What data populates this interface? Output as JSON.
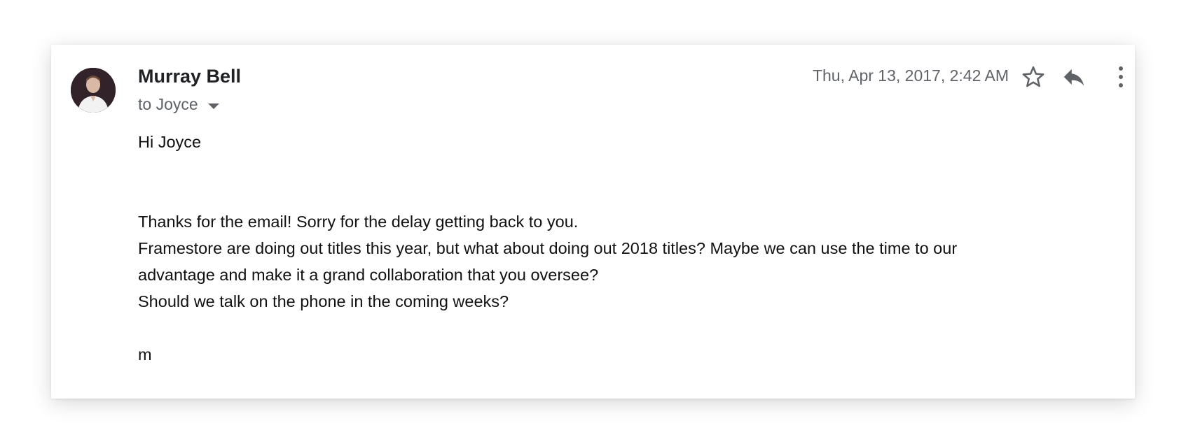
{
  "email": {
    "sender_name": "Murray Bell",
    "recipient_line": "to Joyce",
    "timestamp": "Thu, Apr 13, 2017, 2:42 AM",
    "body": {
      "greeting": "Hi Joyce",
      "paragraph_lines": [
        "Thanks for the email! Sorry for the delay getting back to you.",
        "Framestore are doing out titles this year, but what about doing out 2018 titles? Maybe we can use the time to our",
        "advantage and make it a grand collaboration that you oversee?",
        "Should we talk on the phone in the coming weeks?"
      ],
      "signoff": "m"
    }
  },
  "icons": {
    "avatar": "avatar-photo",
    "recipient_caret": "caret-down-icon",
    "star": "star-outline-icon",
    "reply": "reply-icon",
    "more": "more-vert-icon"
  },
  "colors": {
    "primary_text": "#202124",
    "secondary_text": "#5f6368",
    "icon": "#5f6368",
    "body_text": "#111111"
  }
}
